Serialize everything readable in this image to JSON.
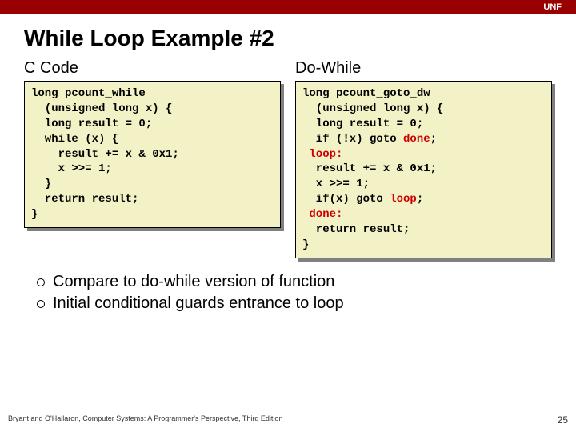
{
  "brand": "UNF",
  "title": "While Loop Example #2",
  "left": {
    "heading": "C Code",
    "code_lines": [
      {
        "t": "long pcount_while"
      },
      {
        "t": "  (unsigned long x) {"
      },
      {
        "t": "  long result = 0;"
      },
      {
        "t": "  while (x) {"
      },
      {
        "t": "    result += x & 0x1;"
      },
      {
        "t": "    x >>= 1;"
      },
      {
        "t": "  }"
      },
      {
        "t": "  return result;"
      },
      {
        "t": "}"
      }
    ]
  },
  "right": {
    "heading": "Do-While",
    "code_lines": [
      {
        "t": "long pcount_goto_dw"
      },
      {
        "t": "  (unsigned long x) {"
      },
      {
        "t": "  long result = 0;"
      },
      {
        "t": "  if (!x) goto ",
        "kw": "done",
        "tail": ";"
      },
      {
        "t": " ",
        "kw": "loop:"
      },
      {
        "t": "  result += x & 0x1;"
      },
      {
        "t": "  x >>= 1;"
      },
      {
        "t": "  if(x) goto ",
        "kw": "loop",
        "tail": ";"
      },
      {
        "t": " ",
        "kw": "done:"
      },
      {
        "t": "  return result;"
      },
      {
        "t": "}"
      }
    ]
  },
  "bullets": [
    "Compare to do-while version of function",
    "Initial conditional guards entrance to loop"
  ],
  "footer": "Bryant and O'Hallaron, Computer Systems: A Programmer's Perspective, Third Edition",
  "page": "25"
}
